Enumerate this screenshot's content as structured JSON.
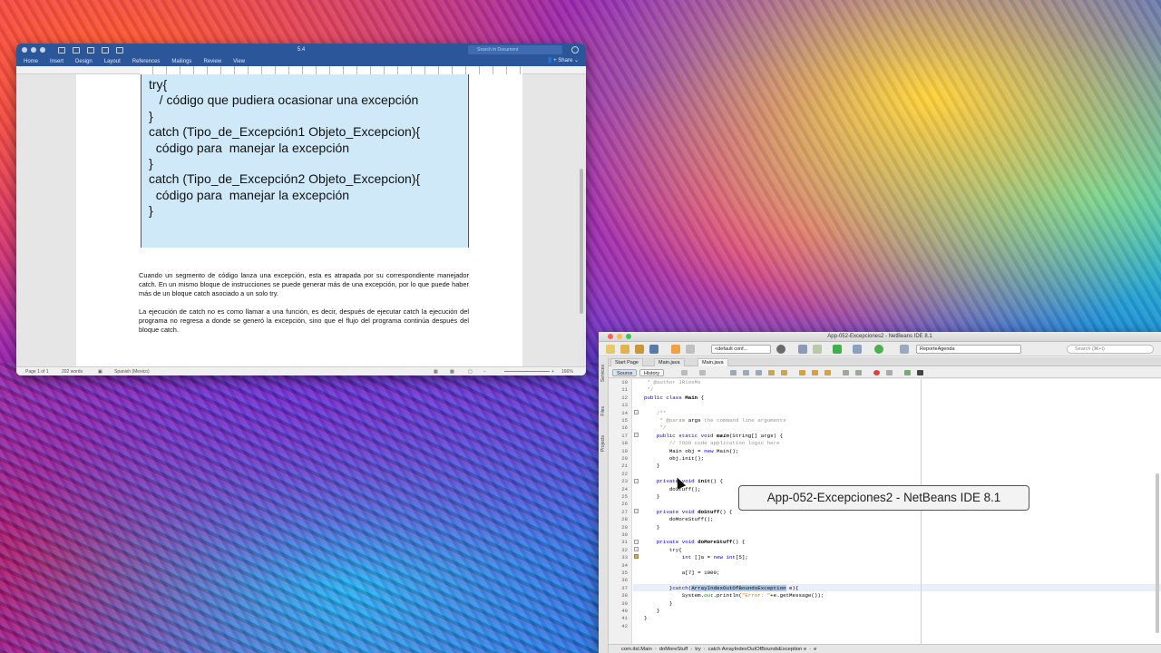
{
  "word": {
    "doc_title": "5.4",
    "search_placeholder": "Search in Document",
    "ribbon_tabs": [
      "Home",
      "Insert",
      "Design",
      "Layout",
      "References",
      "Mailings",
      "Review",
      "View"
    ],
    "share_label": "Share",
    "code_lines": [
      "try{",
      "   / código que pudiera ocasionar una excepción",
      "}",
      "",
      "catch (Tipo_de_Excepción1 Objeto_Excepcion){",
      "  código para  manejar la excepción",
      "}",
      "",
      "catch (Tipo_de_Excepción2 Objeto_Excepcion){",
      "  código para  manejar la excepción",
      "}"
    ],
    "paragraph1": "Cuando un segmento de código lanza una excepción, esta es atrapada por su correspondiente manejador catch. En un mismo bloque de instrucciones se puede generar más de una excepción, por lo que puede haber más de un bloque catch asociado a un solo try.",
    "paragraph2": "La ejecución de catch no es como llamar a una función, es decir, después de ejecutar catch la ejecución del programa no regresa a donde se generó la excepción, sino que el flujo del programa continúa después del bloque catch.",
    "status": {
      "page": "Page 1 of 1",
      "words": "202 words",
      "language": "Spanish (Mexico)",
      "zoom": "166%"
    }
  },
  "netbeans": {
    "title": "App-052-Excepciones2 - NetBeans IDE 8.1",
    "config_combo": "<default conf...",
    "project_combo": "ReporteAgenda",
    "search_placeholder": "Search (⌘+I)",
    "side_labels": [
      "Services",
      "Files",
      "Projects"
    ],
    "tabs": [
      "Start Page",
      "Main.java",
      "Main.java"
    ],
    "source_label": "Source",
    "history_label": "History",
    "line_numbers": [
      "10",
      "11",
      "12",
      "13",
      "14",
      "15",
      "16",
      "17",
      "18",
      "19",
      "20",
      "21",
      "22",
      "23",
      "24",
      "25",
      "26",
      "27",
      "28",
      "29",
      "30",
      "31",
      "32",
      "33",
      "34",
      "35",
      "36",
      "37",
      "38",
      "39",
      "40",
      "41",
      "42"
    ],
    "code": {
      "l10": " * @author JRiosMx",
      "l11": " */",
      "l12_kw": "public class ",
      "l12_name": "Main",
      "l12_rest": " {",
      "l14": "    /**",
      "l15_a": "     * ",
      "l15_b": "@param",
      "l15_c": " args",
      "l15_d": " the command line arguments",
      "l16": "     */",
      "l17_kw": "    public static void ",
      "l17_name": "main",
      "l17_rest": "(String[] args) {",
      "l18": "        // TODO code application logic here",
      "l19_a": "        Main obj = ",
      "l19_kw": "new",
      "l19_b": " Main();",
      "l20": "        obj.init();",
      "l21": "    }",
      "l23_kw": "    private void ",
      "l23_name": "init",
      "l23_rest": "() {",
      "l24": "        doStuff();",
      "l25": "    }",
      "l27_kw": "    private void ",
      "l27_name": "doStuff",
      "l27_rest": "() {",
      "l28": "        doMoreStuff();",
      "l29": "    }",
      "l31_kw": "    private void ",
      "l31_name": "doMoreStuff",
      "l31_rest": "() {",
      "l32_kw": "        try",
      "l32_rest": "{",
      "l33_kw": "            int",
      "l33_a": " []a = ",
      "l33_kw2": "new int",
      "l33_b": "[5];",
      "l35": "            a[7] = 1000;",
      "l37_a": "        }",
      "l37_kw": "catch",
      "l37_b": "(",
      "l37_sel": "ArrayIndexOutOfBoundsException",
      "l37_c": " e){",
      "l38_a": "            System.",
      "l38_out": "out",
      "l38_b": ".println(",
      "l38_str": "\"Error: \"",
      "l38_c": "+e.getMessage());",
      "l39": "        }",
      "l40": "    }",
      "l41": "}"
    },
    "breadcrumb": [
      "com.itsl.Main",
      "doMoreStuff",
      "try",
      "catch ArrayIndexOutOfBoundsException e",
      "e"
    ]
  },
  "tooltip": "App-052-Excepciones2 - NetBeans IDE 8.1"
}
